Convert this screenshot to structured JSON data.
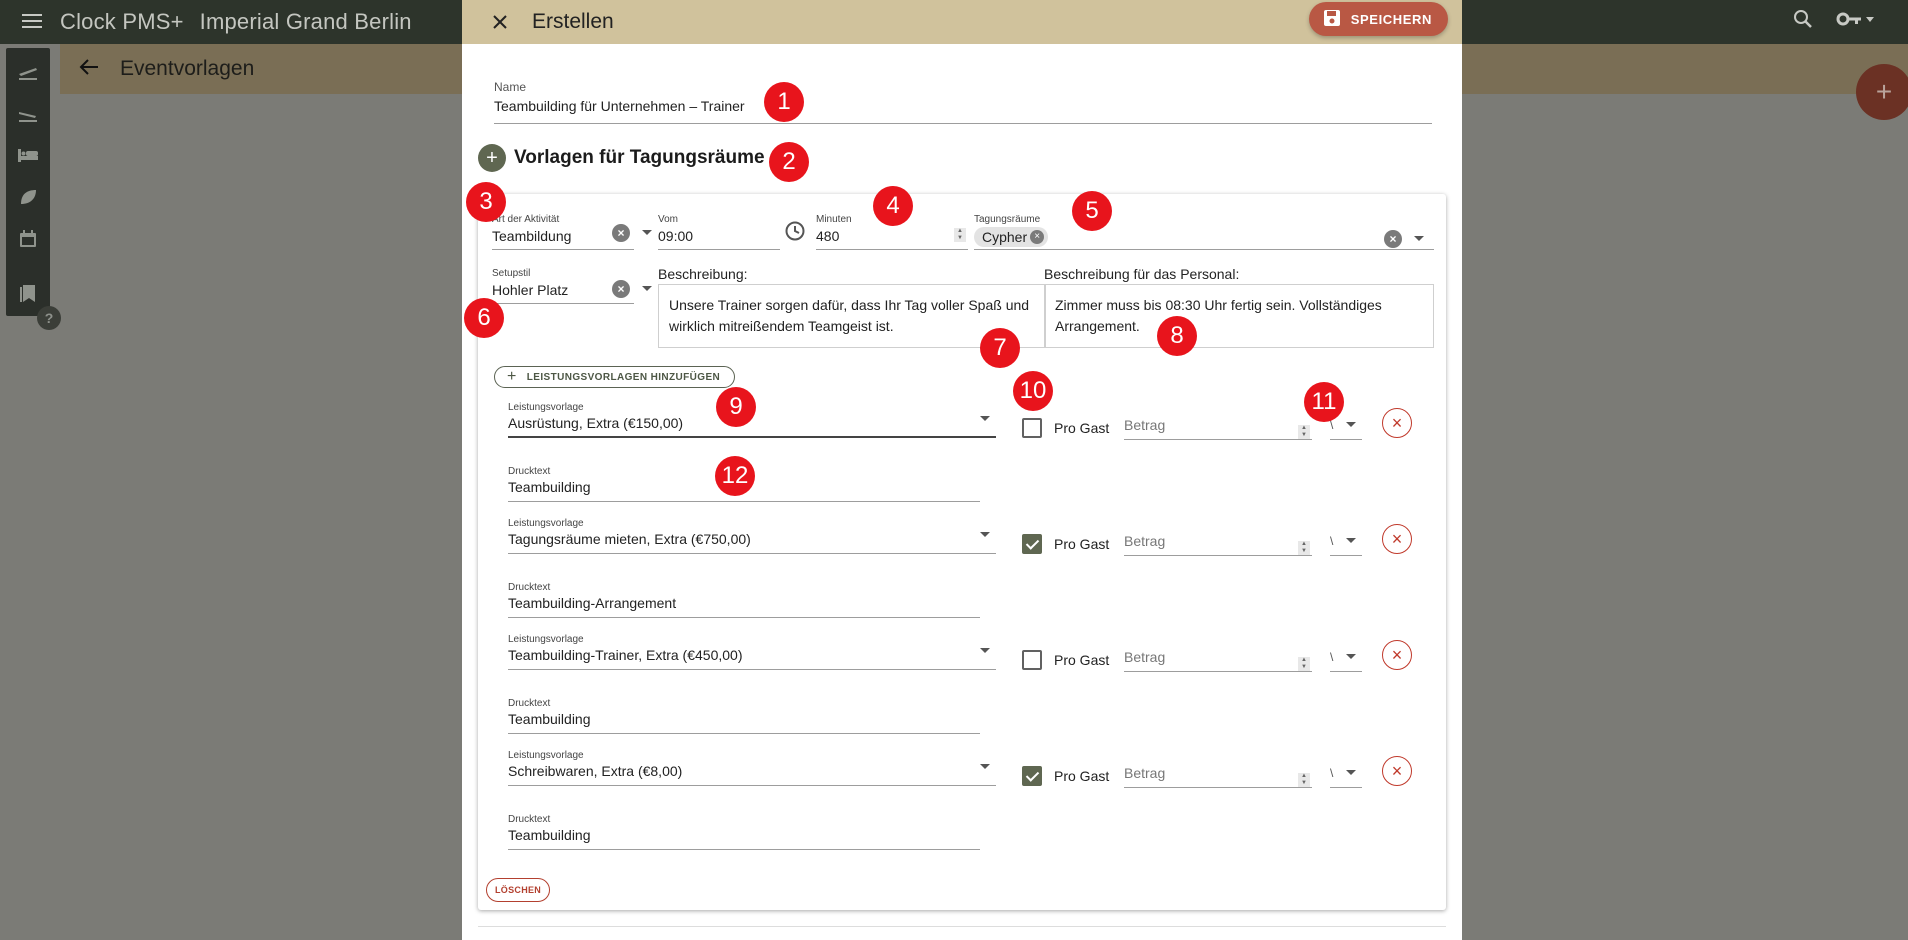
{
  "app": {
    "name": "Clock PMS+",
    "hotel": "Imperial Grand Berlin"
  },
  "subbar": {
    "title": "Eventvorlagen"
  },
  "dialog": {
    "title": "Erstellen",
    "save_label": "SPEICHERN",
    "name_label": "Name",
    "name_value": "Teambuilding für Unternehmen – Trainer",
    "section_title": "Vorlagen für Tagungsräume"
  },
  "card": {
    "activity": {
      "label": "Art der Aktivität",
      "value": "Teambildung"
    },
    "from": {
      "label": "Vom",
      "value": "09:00"
    },
    "minutes": {
      "label": "Minuten",
      "value": "480"
    },
    "rooms": {
      "label": "Tagungsräume",
      "chip": "Cypher"
    },
    "setup": {
      "label": "Setupstil",
      "value": "Hohler Platz"
    },
    "description": {
      "label": "Beschreibung:",
      "text": "Unsere Trainer sorgen dafür, dass Ihr Tag voller Spaß und wirklich mitreißendem Teamgeist ist."
    },
    "staff_description": {
      "label": "Beschreibung für das Personal:",
      "text": "Zimmer muss bis 08:30 Uhr fertig sein. Vollständiges Arrangement."
    },
    "add_service_label": "LEISTUNGSVORLAGEN HINZUFÜGEN",
    "delete_label": "LÖSCHEN"
  },
  "service_rows": [
    {
      "lv_label": "Leistungsvorlage",
      "lv_value": "Ausrüstung, Extra (€150,00)",
      "pro_gast": false,
      "pro_gast_label": "Pro Gast",
      "betrag_placeholder": "Betrag",
      "unit": "\\",
      "dt_label": "Drucktext",
      "dt_value": "Teambuilding"
    },
    {
      "lv_label": "Leistungsvorlage",
      "lv_value": "Tagungsräume mieten, Extra (€750,00)",
      "pro_gast": true,
      "pro_gast_label": "Pro Gast",
      "betrag_placeholder": "Betrag",
      "unit": "\\",
      "dt_label": "Drucktext",
      "dt_value": "Teambuilding-Arrangement"
    },
    {
      "lv_label": "Leistungsvorlage",
      "lv_value": "Teambuilding-Trainer, Extra (€450,00)",
      "pro_gast": false,
      "pro_gast_label": "Pro Gast",
      "betrag_placeholder": "Betrag",
      "unit": "\\",
      "dt_label": "Drucktext",
      "dt_value": "Teambuilding"
    },
    {
      "lv_label": "Leistungsvorlage",
      "lv_value": "Schreibwaren, Extra (€8,00)",
      "pro_gast": true,
      "pro_gast_label": "Pro Gast",
      "betrag_placeholder": "Betrag",
      "unit": "\\",
      "dt_label": "Drucktext",
      "dt_value": "Teambuilding"
    }
  ],
  "markers": [
    "1",
    "2",
    "3",
    "4",
    "5",
    "6",
    "7",
    "8",
    "9",
    "10",
    "11",
    "12"
  ],
  "colors": {
    "header": "#d0c29c",
    "save": "#b95844",
    "accent": "#5f6751",
    "marker": "#e8141c"
  }
}
